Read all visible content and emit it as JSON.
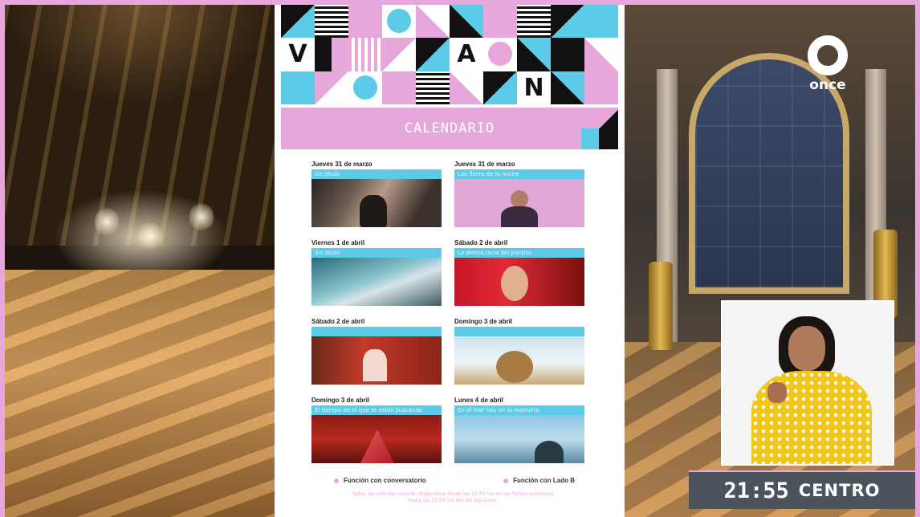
{
  "poster": {
    "pattern_letters": [
      "V",
      "A",
      "N"
    ],
    "calendar_title": "CALENDARIO",
    "events": [
      {
        "date": "Jueves 31 de marzo",
        "title": "Sin título"
      },
      {
        "date": "Jueves 31 de marzo",
        "title": "Las flores de la noche"
      },
      {
        "date": "Viernes 1 de abril",
        "title": "Sin título"
      },
      {
        "date": "Sábado 2 de abril",
        "title": "La democracia del paraíso"
      },
      {
        "date": "Sábado 2 de abril",
        "title": ""
      },
      {
        "date": "Domingo 3 de abril",
        "title": ""
      },
      {
        "date": "Domingo 3 de abril",
        "title": "El tiempo en el que te estás buscando"
      },
      {
        "date": "Lunes 4 de abril",
        "title": "En el mar hay en la memoria"
      }
    ],
    "legend": {
      "item1": "Función con conversatorio",
      "item2": "Función con Lado B"
    },
    "footnote": "Todas las películas estarán disponibles desde las 10:00 hrs en las fechas señaladas hasta las 23:59 hrs del día siguiente."
  },
  "logo": {
    "text": "once"
  },
  "clock": {
    "time": "21:55",
    "zone": "CENTRO"
  },
  "colors": {
    "pink": "#e6a8da",
    "blue": "#5ccbe8",
    "frame": "#e7a6dc"
  }
}
